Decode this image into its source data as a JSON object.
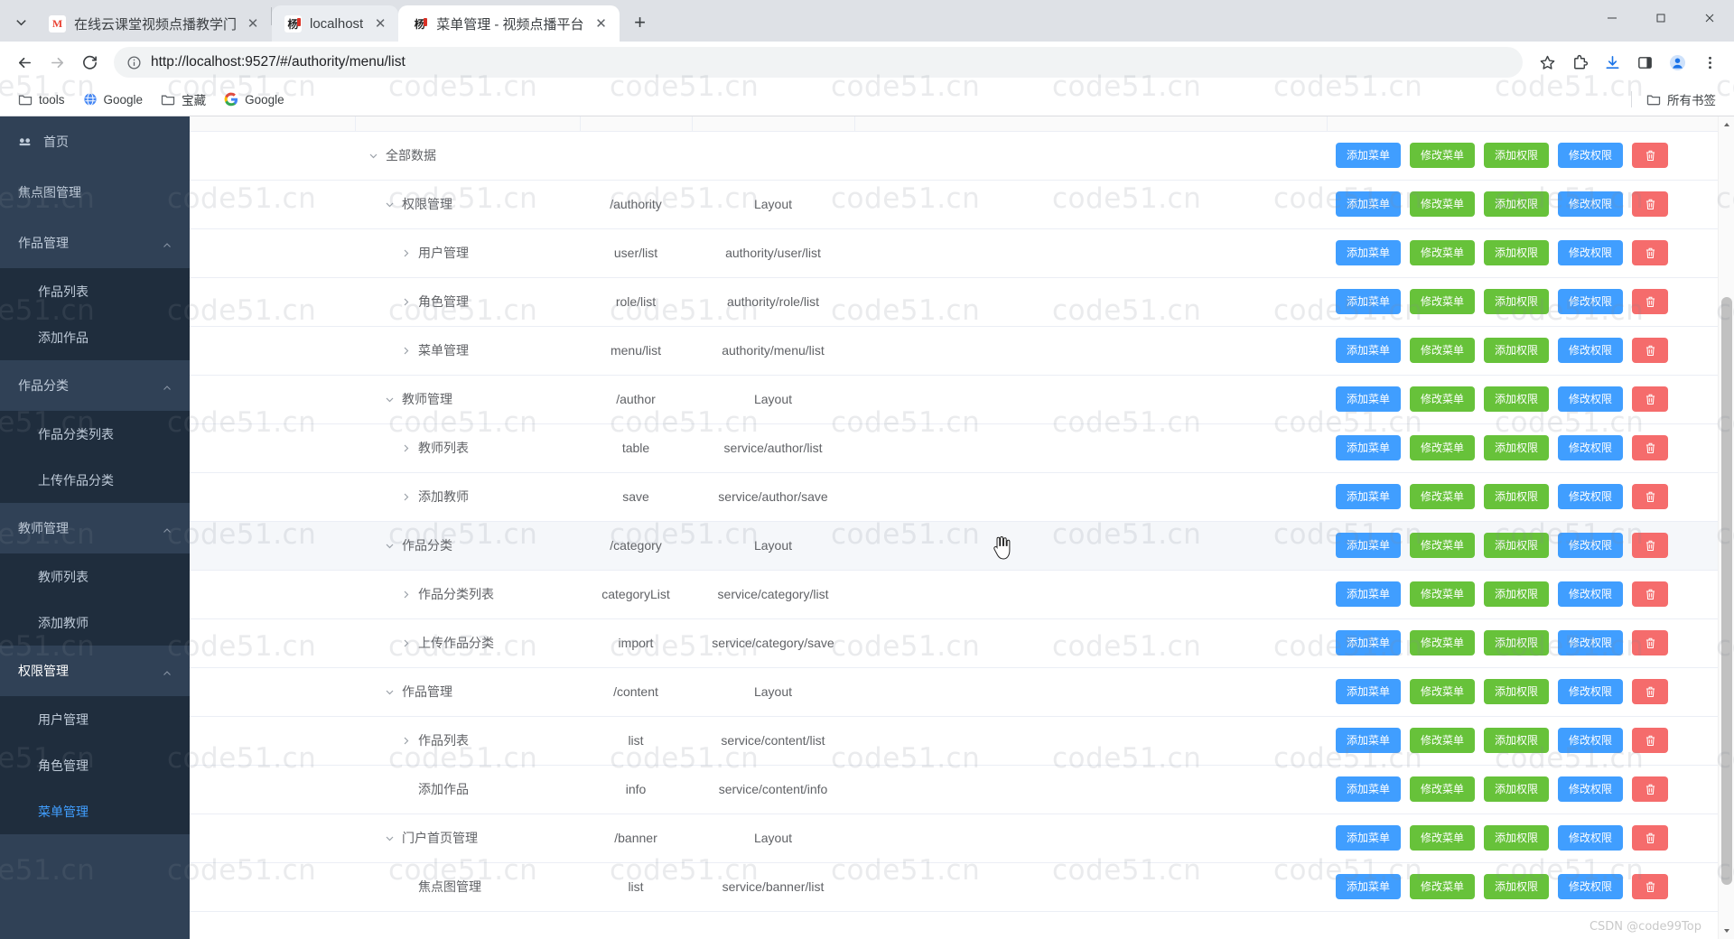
{
  "browser": {
    "tabs": [
      {
        "title": "在线云课堂视频点播教学门户系",
        "favicon": "gmail-icon",
        "state": "inactive"
      },
      {
        "title": "localhost",
        "favicon": "site-icon",
        "state": "semi"
      },
      {
        "title": "菜单管理 - 视频点播平台",
        "favicon": "site-icon",
        "state": "active"
      }
    ],
    "new_tab_label": "+",
    "close_label": "✕",
    "url": "http://localhost:9527/#/authority/menu/list",
    "bookmarks": [
      {
        "label": "tools",
        "icon": "folder-icon"
      },
      {
        "label": "Google",
        "icon": "globe-icon"
      },
      {
        "label": "宝藏",
        "icon": "folder-icon"
      },
      {
        "label": "Google",
        "icon": "google-icon"
      }
    ],
    "all_bookmarks_label": "所有书签",
    "toolbar_icons": [
      "back-icon",
      "forward-icon",
      "reload-icon",
      "info-icon",
      "star-icon",
      "extensions-icon",
      "download-icon",
      "side-panel-icon",
      "profile-icon",
      "more-menu-icon"
    ],
    "window_controls": [
      "minimize-icon",
      "maximize-icon",
      "close-icon"
    ]
  },
  "sidebar": {
    "items": [
      {
        "label": "首页",
        "icon": "dashboard-icon",
        "type": "link",
        "active": false
      },
      {
        "label": "焦点图管理",
        "icon": "",
        "type": "link",
        "active": false
      },
      {
        "label": "作品管理",
        "icon": "",
        "type": "group",
        "expanded": true,
        "children": [
          {
            "label": "作品列表",
            "active": false
          },
          {
            "label": "添加作品",
            "active": false
          }
        ]
      },
      {
        "label": "作品分类",
        "icon": "",
        "type": "group",
        "expanded": true,
        "children": [
          {
            "label": "作品分类列表",
            "active": false
          },
          {
            "label": "上传作品分类",
            "active": false
          }
        ]
      },
      {
        "label": "教师管理",
        "icon": "",
        "type": "group",
        "expanded": true,
        "children": [
          {
            "label": "教师列表",
            "active": false
          },
          {
            "label": "添加教师",
            "active": false
          }
        ]
      },
      {
        "label": "权限管理",
        "icon": "",
        "type": "group",
        "expanded": true,
        "children": [
          {
            "label": "用户管理",
            "active": false
          },
          {
            "label": "角色管理",
            "active": false
          },
          {
            "label": "菜单管理",
            "active": true
          }
        ]
      }
    ]
  },
  "table": {
    "buttons": {
      "add_menu": "添加菜单",
      "edit_menu": "修改菜单",
      "add_permission": "添加权限",
      "edit_permission": "修改权限",
      "delete": "delete-icon"
    },
    "colors": {
      "primary": "#409EFF",
      "success": "#67C23A",
      "danger": "#F56C6C",
      "row_hover": "#F5F7FA",
      "border": "#EBEEF5",
      "sidebar_bg": "#304156",
      "sidebar_sub_bg": "#1F2D3D",
      "sidebar_active_text": "#409EFF"
    },
    "rows": [
      {
        "name": "全部数据",
        "level": 0,
        "caret": "down",
        "path": "",
        "component": "",
        "hovered": false
      },
      {
        "name": "权限管理",
        "level": 1,
        "caret": "down",
        "path": "/authority",
        "component": "Layout",
        "hovered": false
      },
      {
        "name": "用户管理",
        "level": 2,
        "caret": "right",
        "path": "user/list",
        "component": "authority/user/list",
        "hovered": false
      },
      {
        "name": "角色管理",
        "level": 2,
        "caret": "right",
        "path": "role/list",
        "component": "authority/role/list",
        "hovered": false
      },
      {
        "name": "菜单管理",
        "level": 2,
        "caret": "right",
        "path": "menu/list",
        "component": "authority/menu/list",
        "hovered": false
      },
      {
        "name": "教师管理",
        "level": 1,
        "caret": "down",
        "path": "/author",
        "component": "Layout",
        "hovered": false
      },
      {
        "name": "教师列表",
        "level": 2,
        "caret": "right",
        "path": "table",
        "component": "service/author/list",
        "hovered": false
      },
      {
        "name": "添加教师",
        "level": 2,
        "caret": "right",
        "path": "save",
        "component": "service/author/save",
        "hovered": false
      },
      {
        "name": "作品分类",
        "level": 1,
        "caret": "down",
        "path": "/category",
        "component": "Layout",
        "hovered": true
      },
      {
        "name": "作品分类列表",
        "level": 2,
        "caret": "right",
        "path": "categoryList",
        "component": "service/category/list",
        "hovered": false
      },
      {
        "name": "上传作品分类",
        "level": 2,
        "caret": "right",
        "path": "import",
        "component": "service/category/save",
        "hovered": false
      },
      {
        "name": "作品管理",
        "level": 1,
        "caret": "down",
        "path": "/content",
        "component": "Layout",
        "hovered": false
      },
      {
        "name": "作品列表",
        "level": 2,
        "caret": "right",
        "path": "list",
        "component": "service/content/list",
        "hovered": false
      },
      {
        "name": "添加作品",
        "level": 2,
        "caret": "none",
        "path": "info",
        "component": "service/content/info",
        "hovered": false
      },
      {
        "name": "门户首页管理",
        "level": 1,
        "caret": "down",
        "path": "/banner",
        "component": "Layout",
        "hovered": false
      },
      {
        "name": "焦点图管理",
        "level": 2,
        "caret": "none",
        "path": "list",
        "component": "service/banner/list",
        "hovered": false
      }
    ]
  },
  "watermark": {
    "text": "code51.cn",
    "footer": "CSDN @code99Top"
  }
}
